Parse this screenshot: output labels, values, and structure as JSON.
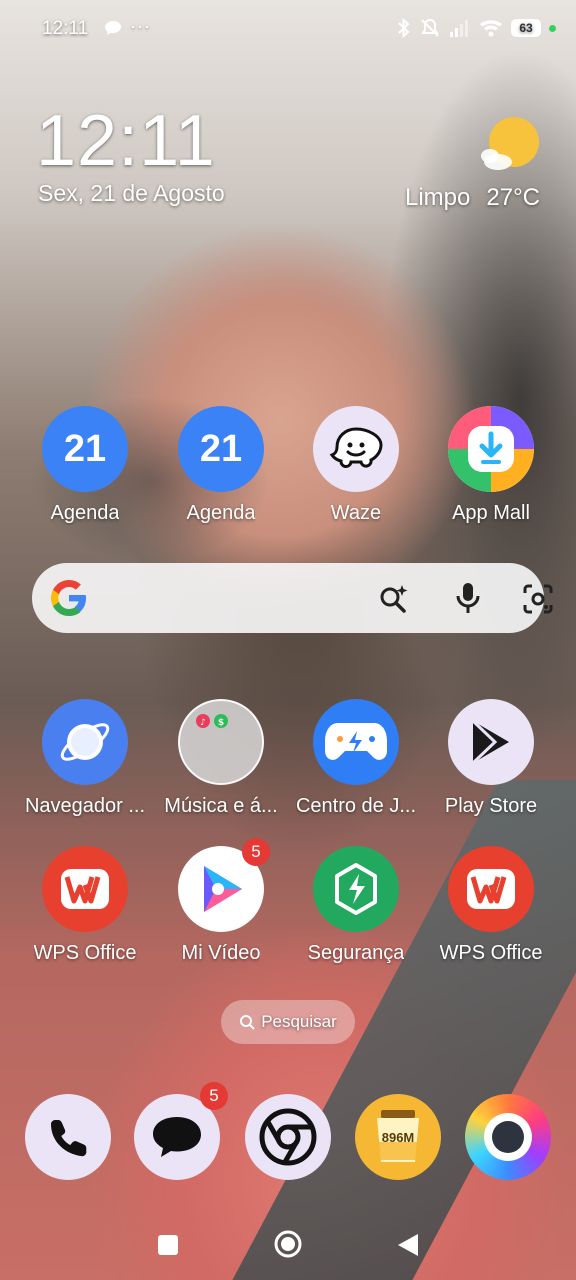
{
  "status_bar": {
    "time": "12:11",
    "more_dots": "···",
    "battery": "63"
  },
  "clock_widget": {
    "time": "12:11",
    "date": "Sex, 21 de Agosto",
    "weather_condition": "Limpo",
    "temperature": "27°C"
  },
  "apps_row1": [
    {
      "label": "Agenda",
      "icon": "calendar-icon",
      "day": "21",
      "color": "#3b82f6"
    },
    {
      "label": "Agenda",
      "icon": "calendar-icon",
      "day": "21",
      "color": "#3b82f6"
    },
    {
      "label": "Waze",
      "icon": "waze-icon",
      "color": "#ebe4f7"
    },
    {
      "label": "App Mall",
      "icon": "app-mall-icon",
      "color": "#ffffff"
    }
  ],
  "apps_row2": [
    {
      "label": "Navegador ...",
      "icon": "browser-icon",
      "color": "#4a7ff0"
    },
    {
      "label": "Música e á...",
      "icon": "folder-icon",
      "color": "#d8d8d8"
    },
    {
      "label": "Centro de J...",
      "icon": "game-center-icon",
      "color": "#2f7ef5"
    },
    {
      "label": "Play Store",
      "icon": "play-store-icon",
      "color": "#ebe4f7"
    }
  ],
  "apps_row3": [
    {
      "label": "WPS Office",
      "icon": "wps-office-icon",
      "color": "#e8402f"
    },
    {
      "label": "Mi Vídeo",
      "icon": "mi-video-icon",
      "color": "#ffffff",
      "badge": "5"
    },
    {
      "label": "Segurança",
      "icon": "security-icon",
      "color": "#22a95f"
    },
    {
      "label": "WPS Office",
      "icon": "wps-office-icon",
      "color": "#e8402f"
    }
  ],
  "search_pill": {
    "label": "Pesquisar"
  },
  "dock": [
    {
      "icon": "phone-icon",
      "color": "#ebe4f7"
    },
    {
      "icon": "messages-icon",
      "color": "#ebe4f7",
      "badge": "5"
    },
    {
      "icon": "chrome-icon",
      "color": "#ebe4f7"
    },
    {
      "icon": "cleaner-icon",
      "color": "#f6b832",
      "text": "896M"
    },
    {
      "icon": "browser-ring-icon",
      "color": "#ff7a3d"
    }
  ]
}
